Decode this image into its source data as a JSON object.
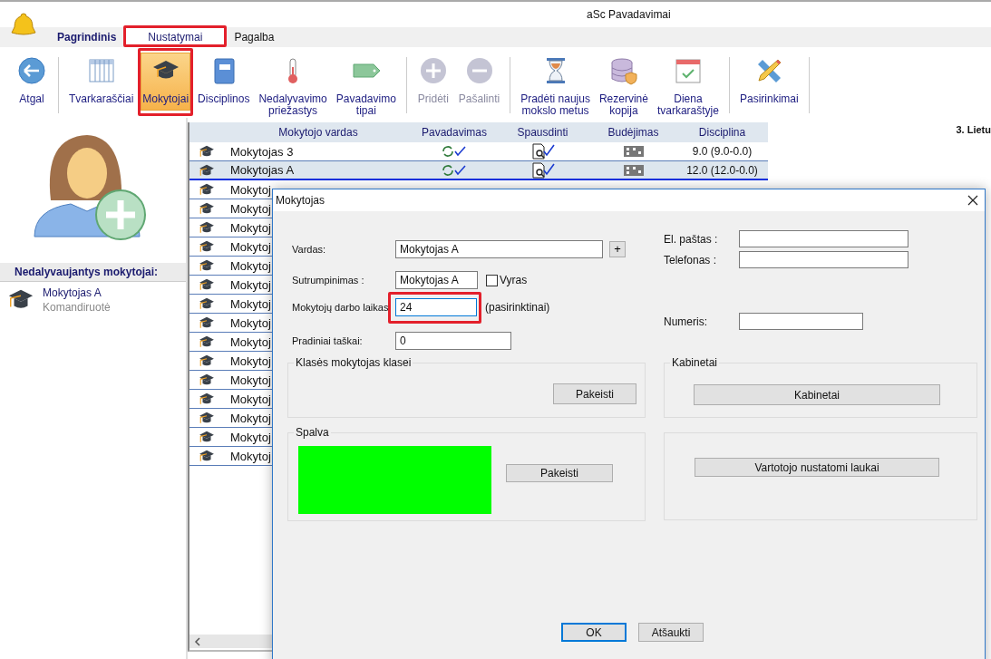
{
  "window": {
    "title": "aSc Pavadavimai"
  },
  "ribbon_tabs": [
    {
      "label": "Pagrindinis",
      "kind": "home",
      "selected": false,
      "highlighted": false
    },
    {
      "label": "Nustatymai",
      "kind": "tab",
      "selected": true,
      "highlighted": true
    },
    {
      "label": "Pagalba",
      "kind": "tab",
      "selected": false,
      "highlighted": false
    }
  ],
  "toolbar": [
    [
      {
        "label": "Atgal",
        "selected": false,
        "disabled": false,
        "highlighted": false
      }
    ],
    [
      {
        "label": "Tvarkaraščiai",
        "selected": false,
        "disabled": false,
        "highlighted": false
      },
      {
        "label": "Mokytojai",
        "selected": true,
        "disabled": false,
        "highlighted": true
      },
      {
        "label": "Disciplinos",
        "selected": false,
        "disabled": false,
        "highlighted": false
      },
      {
        "label": "Nedalyvavimo\npriežastys",
        "selected": false,
        "disabled": false,
        "highlighted": false
      },
      {
        "label": "Pavadavimo\ntipai",
        "selected": false,
        "disabled": false,
        "highlighted": false
      }
    ],
    [
      {
        "label": "Pridėti",
        "selected": false,
        "disabled": true,
        "highlighted": false
      },
      {
        "label": "Pašalinti",
        "selected": false,
        "disabled": true,
        "highlighted": false
      }
    ],
    [
      {
        "label": "Pradėti naujus\nmokslo metus",
        "selected": false,
        "disabled": false,
        "highlighted": false
      },
      {
        "label": "Rezervinė\nkopija",
        "selected": false,
        "disabled": false,
        "highlighted": false
      },
      {
        "label": "Diena\ntvarkaraštyje",
        "selected": false,
        "disabled": false,
        "highlighted": false
      }
    ],
    [
      {
        "label": "Pasirinkimai",
        "selected": false,
        "disabled": false,
        "highlighted": false
      }
    ]
  ],
  "absent_panel": {
    "title": "Nedalyvaujantys mokytojai:",
    "items": [
      {
        "name": "Mokytojas A",
        "reason": "Komandiruotė"
      }
    ]
  },
  "table": {
    "columns": [
      "Mokytojo vardas",
      "Pavadavimas",
      "Spausdinti",
      "Budėjimas",
      "Disciplina"
    ],
    "rows": [
      {
        "name": "Mokytojas 3",
        "discipline": "9.0 (9.0-0.0)",
        "selected": false
      },
      {
        "name": "Mokytojas A",
        "discipline": "12.0 (12.0-0.0)",
        "selected": true
      },
      {
        "name": "Mokytoj",
        "selected": false
      },
      {
        "name": "Mokytoj",
        "selected": false
      },
      {
        "name": "Mokytoj",
        "selected": false
      },
      {
        "name": "Mokytoj",
        "selected": false
      },
      {
        "name": "Mokytoj",
        "selected": false
      },
      {
        "name": "Mokytoj",
        "selected": false
      },
      {
        "name": "Mokytoj",
        "selected": false
      },
      {
        "name": "Mokytoj",
        "selected": false
      },
      {
        "name": "Mokytoj",
        "selected": false
      },
      {
        "name": "Mokytoj",
        "selected": false
      },
      {
        "name": "Mokytoj",
        "selected": false
      },
      {
        "name": "Mokytoj",
        "selected": false
      },
      {
        "name": "Mokytoj",
        "selected": false
      },
      {
        "name": "Mokytoj",
        "selected": false
      },
      {
        "name": "Mokytoj",
        "selected": false
      }
    ]
  },
  "right_panel": {
    "heading": "3. Lietu"
  },
  "dialog": {
    "title": "Mokytojas",
    "name": {
      "label": "Vardas:",
      "value": "Mokytojas A",
      "add": "+"
    },
    "abbreviation": {
      "label": "Sutrumpinimas :",
      "value": "Mokytojas A"
    },
    "male": {
      "label": "Vyras",
      "checked": false
    },
    "work_time": {
      "label": "Mokytojų darbo laikas",
      "value": "24",
      "hint": "(pasirinktinai)",
      "focused": true,
      "highlighted": true
    },
    "initial_points": {
      "label": "Pradiniai taškai:",
      "value": "0"
    },
    "email": {
      "label": "El. paštas :"
    },
    "phone": {
      "label": "Telefonas :"
    },
    "number": {
      "label": "Numeris:"
    },
    "class_teacher": {
      "title": "Klasės mokytojas klasei",
      "button": "Pakeisti"
    },
    "color": {
      "title": "Spalva",
      "color": "#00ff00",
      "button": "Pakeisti"
    },
    "rooms": {
      "title": "Kabinetai",
      "button": "Kabinetai"
    },
    "custom": {
      "button": "Vartotojo nustatomi laukai"
    },
    "buttons": [
      {
        "label": "OK",
        "default": true
      },
      {
        "label": "Atšaukti",
        "default": false
      }
    ]
  }
}
